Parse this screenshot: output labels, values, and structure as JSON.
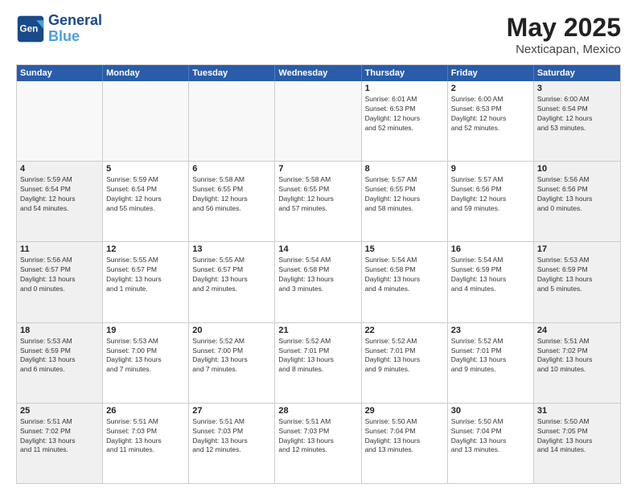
{
  "header": {
    "logo_line1": "General",
    "logo_line2": "Blue",
    "title": "May 2025",
    "subtitle": "Nexticapan, Mexico"
  },
  "days_of_week": [
    "Sunday",
    "Monday",
    "Tuesday",
    "Wednesday",
    "Thursday",
    "Friday",
    "Saturday"
  ],
  "weeks": [
    [
      {
        "day": "",
        "text": "",
        "empty": true
      },
      {
        "day": "",
        "text": "",
        "empty": true
      },
      {
        "day": "",
        "text": "",
        "empty": true
      },
      {
        "day": "",
        "text": "",
        "empty": true
      },
      {
        "day": "1",
        "text": "Sunrise: 6:01 AM\nSunset: 6:53 PM\nDaylight: 12 hours\nand 52 minutes.",
        "empty": false
      },
      {
        "day": "2",
        "text": "Sunrise: 6:00 AM\nSunset: 6:53 PM\nDaylight: 12 hours\nand 52 minutes.",
        "empty": false
      },
      {
        "day": "3",
        "text": "Sunrise: 6:00 AM\nSunset: 6:54 PM\nDaylight: 12 hours\nand 53 minutes.",
        "empty": false
      }
    ],
    [
      {
        "day": "4",
        "text": "Sunrise: 5:59 AM\nSunset: 6:54 PM\nDaylight: 12 hours\nand 54 minutes.",
        "empty": false
      },
      {
        "day": "5",
        "text": "Sunrise: 5:59 AM\nSunset: 6:54 PM\nDaylight: 12 hours\nand 55 minutes.",
        "empty": false
      },
      {
        "day": "6",
        "text": "Sunrise: 5:58 AM\nSunset: 6:55 PM\nDaylight: 12 hours\nand 56 minutes.",
        "empty": false
      },
      {
        "day": "7",
        "text": "Sunrise: 5:58 AM\nSunset: 6:55 PM\nDaylight: 12 hours\nand 57 minutes.",
        "empty": false
      },
      {
        "day": "8",
        "text": "Sunrise: 5:57 AM\nSunset: 6:55 PM\nDaylight: 12 hours\nand 58 minutes.",
        "empty": false
      },
      {
        "day": "9",
        "text": "Sunrise: 5:57 AM\nSunset: 6:56 PM\nDaylight: 12 hours\nand 59 minutes.",
        "empty": false
      },
      {
        "day": "10",
        "text": "Sunrise: 5:56 AM\nSunset: 6:56 PM\nDaylight: 13 hours\nand 0 minutes.",
        "empty": false
      }
    ],
    [
      {
        "day": "11",
        "text": "Sunrise: 5:56 AM\nSunset: 6:57 PM\nDaylight: 13 hours\nand 0 minutes.",
        "empty": false
      },
      {
        "day": "12",
        "text": "Sunrise: 5:55 AM\nSunset: 6:57 PM\nDaylight: 13 hours\nand 1 minute.",
        "empty": false
      },
      {
        "day": "13",
        "text": "Sunrise: 5:55 AM\nSunset: 6:57 PM\nDaylight: 13 hours\nand 2 minutes.",
        "empty": false
      },
      {
        "day": "14",
        "text": "Sunrise: 5:54 AM\nSunset: 6:58 PM\nDaylight: 13 hours\nand 3 minutes.",
        "empty": false
      },
      {
        "day": "15",
        "text": "Sunrise: 5:54 AM\nSunset: 6:58 PM\nDaylight: 13 hours\nand 4 minutes.",
        "empty": false
      },
      {
        "day": "16",
        "text": "Sunrise: 5:54 AM\nSunset: 6:59 PM\nDaylight: 13 hours\nand 4 minutes.",
        "empty": false
      },
      {
        "day": "17",
        "text": "Sunrise: 5:53 AM\nSunset: 6:59 PM\nDaylight: 13 hours\nand 5 minutes.",
        "empty": false
      }
    ],
    [
      {
        "day": "18",
        "text": "Sunrise: 5:53 AM\nSunset: 6:59 PM\nDaylight: 13 hours\nand 6 minutes.",
        "empty": false
      },
      {
        "day": "19",
        "text": "Sunrise: 5:53 AM\nSunset: 7:00 PM\nDaylight: 13 hours\nand 7 minutes.",
        "empty": false
      },
      {
        "day": "20",
        "text": "Sunrise: 5:52 AM\nSunset: 7:00 PM\nDaylight: 13 hours\nand 7 minutes.",
        "empty": false
      },
      {
        "day": "21",
        "text": "Sunrise: 5:52 AM\nSunset: 7:01 PM\nDaylight: 13 hours\nand 8 minutes.",
        "empty": false
      },
      {
        "day": "22",
        "text": "Sunrise: 5:52 AM\nSunset: 7:01 PM\nDaylight: 13 hours\nand 9 minutes.",
        "empty": false
      },
      {
        "day": "23",
        "text": "Sunrise: 5:52 AM\nSunset: 7:01 PM\nDaylight: 13 hours\nand 9 minutes.",
        "empty": false
      },
      {
        "day": "24",
        "text": "Sunrise: 5:51 AM\nSunset: 7:02 PM\nDaylight: 13 hours\nand 10 minutes.",
        "empty": false
      }
    ],
    [
      {
        "day": "25",
        "text": "Sunrise: 5:51 AM\nSunset: 7:02 PM\nDaylight: 13 hours\nand 11 minutes.",
        "empty": false
      },
      {
        "day": "26",
        "text": "Sunrise: 5:51 AM\nSunset: 7:03 PM\nDaylight: 13 hours\nand 11 minutes.",
        "empty": false
      },
      {
        "day": "27",
        "text": "Sunrise: 5:51 AM\nSunset: 7:03 PM\nDaylight: 13 hours\nand 12 minutes.",
        "empty": false
      },
      {
        "day": "28",
        "text": "Sunrise: 5:51 AM\nSunset: 7:03 PM\nDaylight: 13 hours\nand 12 minutes.",
        "empty": false
      },
      {
        "day": "29",
        "text": "Sunrise: 5:50 AM\nSunset: 7:04 PM\nDaylight: 13 hours\nand 13 minutes.",
        "empty": false
      },
      {
        "day": "30",
        "text": "Sunrise: 5:50 AM\nSunset: 7:04 PM\nDaylight: 13 hours\nand 13 minutes.",
        "empty": false
      },
      {
        "day": "31",
        "text": "Sunrise: 5:50 AM\nSunset: 7:05 PM\nDaylight: 13 hours\nand 14 minutes.",
        "empty": false
      }
    ]
  ]
}
